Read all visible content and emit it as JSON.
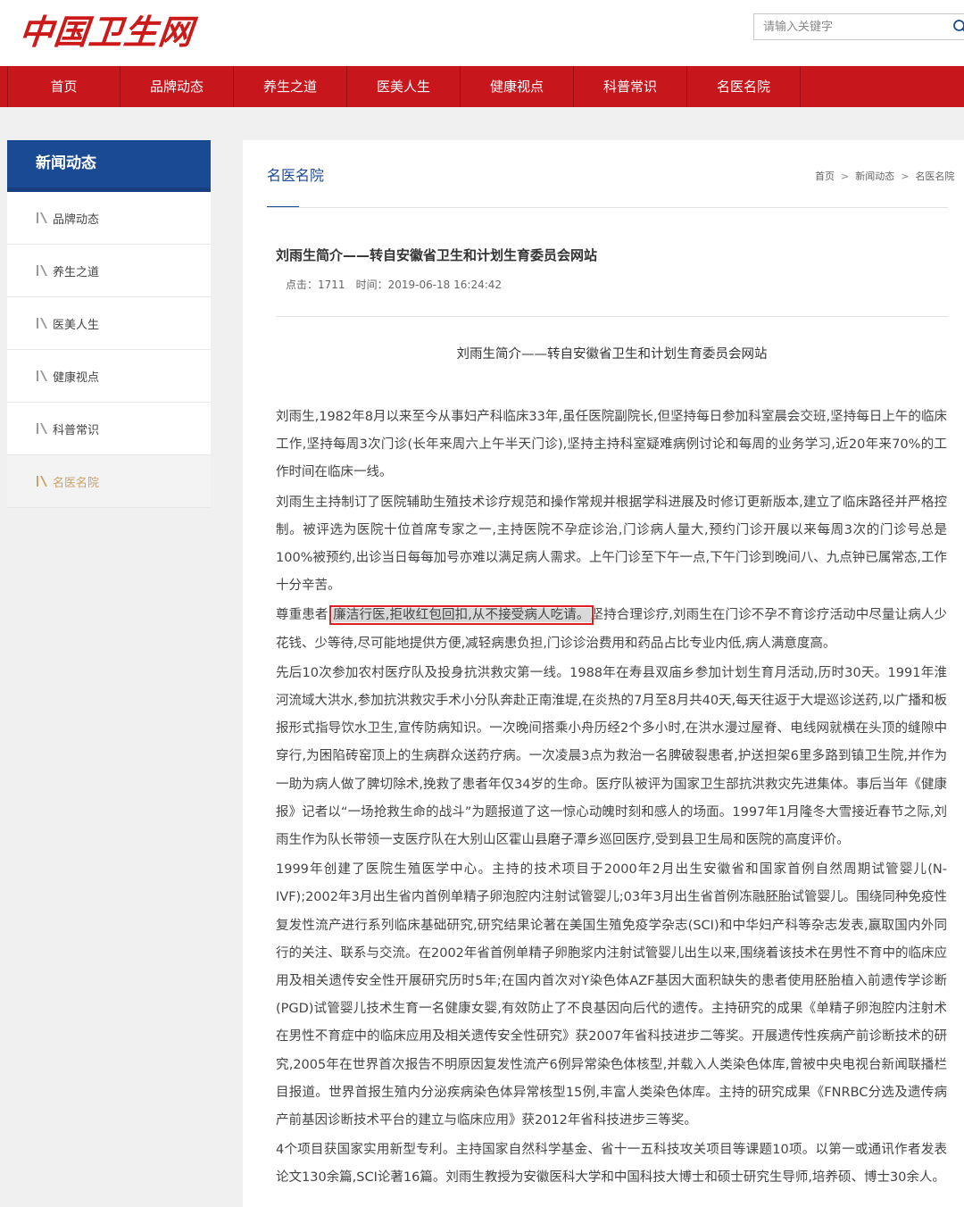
{
  "header": {
    "logo_text": "中国卫生网",
    "search_placeholder": "请输入关键字"
  },
  "nav": {
    "items": [
      "首页",
      "品牌动态",
      "养生之道",
      "医美人生",
      "健康视点",
      "科普常识",
      "名医名院"
    ]
  },
  "sidebar": {
    "title": "新闻动态",
    "items": [
      "品牌动态",
      "养生之道",
      "医美人生",
      "健康视点",
      "科普常识",
      "名医名院"
    ],
    "active_item": "名医名院"
  },
  "content": {
    "section_title": "名医名院",
    "breadcrumb": [
      "首页",
      "新闻动态",
      "名医名院"
    ],
    "breadcrumb_sep": ">",
    "article_title": "刘雨生简介——转自安徽省卫生和计划生育委员会网站",
    "clicks_label": "点击：",
    "clicks": "1711",
    "time_label": "时间：",
    "time": "2019-06-18 16:24:42",
    "subtitle": "刘雨生简介——转自安徽省卫生和计划生育委员会网站",
    "paragraphs": {
      "p1": "刘雨生,1982年8月以来至今从事妇产科临床33年,虽任医院副院长,但坚持每日参加科室晨会交班,坚持每日上午的临床工作,坚持每周3次门诊(长年来周六上午半天门诊),坚持主持科室疑难病例讨论和每周的业务学习,近20年来70%的工作时间在临床一线。",
      "p2": "刘雨生主持制订了医院辅助生殖技术诊疗规范和操作常规并根据学科进展及时修订更新版本,建立了临床路径并严格控制。被评选为医院十位首席专家之一,主持医院不孕症诊治,门诊病人量大,预约门诊开展以来每周3次的门诊号总是100%被预约,出诊当日每每加号亦难以满足病人需求。上午门诊至下午一点,下午门诊到晚间八、九点钟已属常态,工作十分辛苦。",
      "p3_before": "尊重患者,",
      "p3_highlight": "廉洁行医,拒收红包回扣,从不接受病人吃请。",
      "p3_after": "坚持合理诊疗,刘雨生在门诊不孕不育诊疗活动中尽量让病人少花钱、少等待,尽可能地提供方便,减轻病患负担,门诊诊治费用和药品占比专业内低,病人满意度高。",
      "p4": "先后10次参加农村医疗队及投身抗洪救灾第一线。1988年在寿县双庙乡参加计划生育月活动,历时30天。1991年淮河流域大洪水,参加抗洪救灾手术小分队奔赴正南淮堤,在炎热的7月至8月共40天,每天往返于大堤巡诊送药,以广播和板报形式指导饮水卫生,宣传防病知识。一次晚间搭乘小舟历经2个多小时,在洪水漫过屋脊、电线网就横在头顶的缝隙中穿行,为困陷砖窑顶上的生病群众送药疗病。一次凌晨3点为救治一名脾破裂患者,护送担架6里多路到镇卫生院,并作为一助为病人做了脾切除术,挽救了患者年仅34岁的生命。医疗队被评为国家卫生部抗洪救灾先进集体。事后当年《健康报》记者以“一场抢救生命的战斗”为题报道了这一惊心动魄时刻和感人的场面。1997年1月隆冬大雪接近春节之际,刘雨生作为队长带领一支医疗队在大别山区霍山县磨子潭乡巡回医疗,受到县卫生局和医院的高度评价。",
      "p5": "1999年创建了医院生殖医学中心。主持的技术项目于2000年2月出生安徽省和国家首例自然周期试管婴儿(N-IVF);2002年3月出生省内首例单精子卵泡腔内注射试管婴儿;03年3月出生省首例冻融胚胎试管婴儿。围绕同种免疫性复发性流产进行系列临床基础研究,研究结果论著在美国生殖免疫学杂志(SCI)和中华妇产科等杂志发表,赢取国内外同行的关注、联系与交流。在2002年省首例单精子卵胞浆内注射试管婴儿出生以来,围绕着该技术在男性不育中的临床应用及相关遗传安全性开展研究历时5年;在国内首次对Y染色体AZF基因大面积缺失的患者使用胚胎植入前遗传学诊断(PGD)试管婴儿技术生育一名健康女婴,有效防止了不良基因向后代的遗传。主持研究的成果《单精子卵泡腔内注射术在男性不育症中的临床应用及相关遗传安全性研究》获2007年省科技进步二等奖。开展遗传性疾病产前诊断技术的研究,2005年在世界首次报告不明原因复发性流产6例异常染色体核型,并载入人类染色体库,曾被中央电视台新闻联播栏目报道。世界首报生殖内分泌疾病染色体异常核型15例,丰富人类染色体库。主持的研究成果《FNRBC分选及遗传病产前基因诊断技术平台的建立与临床应用》获2012年省科技进步三等奖。",
      "p6": "4个项目获国家实用新型专利。主持国家自然科学基金、省十一五科技攻关项目等课题10项。以第一或通讯作者发表论文130余篇,SCI论著16篇。刘雨生教授为安徽医科大学和中国科技大博士和硕士研究生导师,培养硕、博士30余人。"
    }
  },
  "colors": {
    "brand_red": "#c8161d",
    "sidebar_blue": "#1b4a94",
    "active_gold": "#c8a36a",
    "highlight_box": "#e02020"
  },
  "icons": {
    "search": "search-icon",
    "sidebar_marker": "slash-marker-icon"
  }
}
